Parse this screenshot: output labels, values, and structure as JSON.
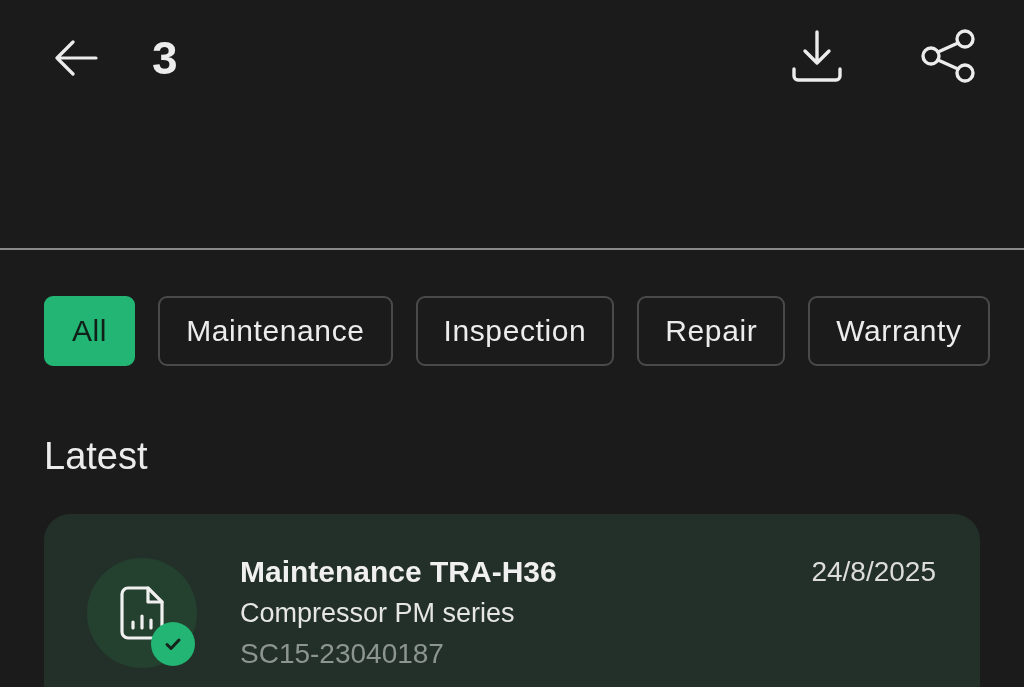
{
  "header": {
    "title": "3"
  },
  "filters": [
    {
      "label": "All",
      "selected": true
    },
    {
      "label": "Maintenance",
      "selected": false
    },
    {
      "label": "Inspection",
      "selected": false
    },
    {
      "label": "Repair",
      "selected": false
    },
    {
      "label": "Warranty",
      "selected": false
    }
  ],
  "section_title": "Latest",
  "records": [
    {
      "title": "Maintenance TRA-H36",
      "subtitle": "Compressor PM series",
      "code": "SC15-23040187",
      "date": "24/8/2025",
      "verified": true
    }
  ]
}
